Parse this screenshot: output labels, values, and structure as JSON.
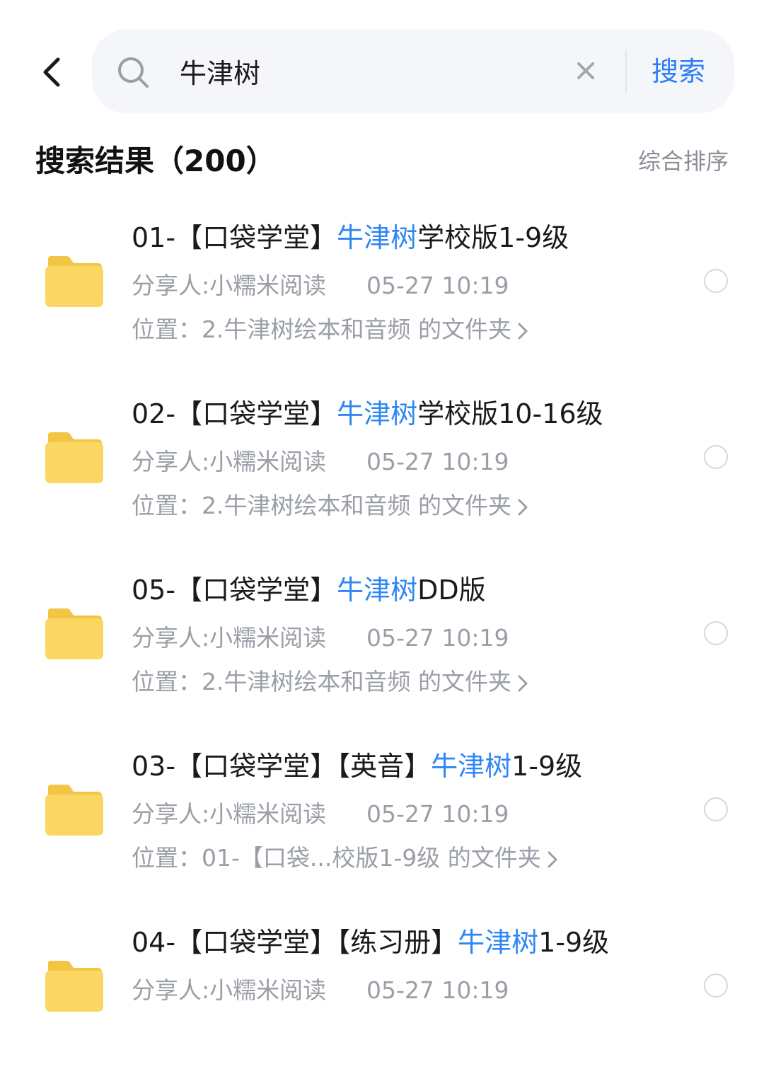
{
  "search": {
    "query": "牛津树",
    "submit_label": "搜索"
  },
  "results": {
    "title": "搜索结果（200）",
    "sort_label": "综合排序"
  },
  "items": [
    {
      "title_prefix": "01-【口袋学堂】",
      "title_highlight": "牛津树",
      "title_suffix": "学校版1-9级",
      "sharer": "分享人:小糯米阅读",
      "time": "05-27 10:19",
      "location": "位置：2.牛津树绘本和音频 的文件夹"
    },
    {
      "title_prefix": "02-【口袋学堂】",
      "title_highlight": "牛津树",
      "title_suffix": "学校版10-16级",
      "sharer": "分享人:小糯米阅读",
      "time": "05-27 10:19",
      "location": "位置：2.牛津树绘本和音频 的文件夹"
    },
    {
      "title_prefix": "05-【口袋学堂】",
      "title_highlight": "牛津树",
      "title_suffix": "DD版",
      "sharer": "分享人:小糯米阅读",
      "time": "05-27 10:19",
      "location": "位置：2.牛津树绘本和音频 的文件夹"
    },
    {
      "title_prefix": "03-【口袋学堂】【英音】",
      "title_highlight": "牛津树",
      "title_suffix": "1-9级",
      "sharer": "分享人:小糯米阅读",
      "time": "05-27 10:19",
      "location": "位置：01-【口袋...校版1-9级 的文件夹"
    },
    {
      "title_prefix": "04-【口袋学堂】【练习册】",
      "title_highlight": "牛津树",
      "title_suffix": "1-9级",
      "sharer": "分享人:小糯米阅读",
      "time": "05-27 10:19",
      "location": ""
    }
  ],
  "icons": {
    "back": "chevron-left-icon",
    "search": "search-icon",
    "clear": "close-icon",
    "folder": "folder-icon",
    "location_arrow": "chevron-right-icon"
  },
  "colors": {
    "accent": "#2f7cf6",
    "highlight": "#2f86f6",
    "folder": "#f9d35c",
    "search_bg": "#f5f6f9",
    "secondary_text": "#9a9ea6"
  }
}
